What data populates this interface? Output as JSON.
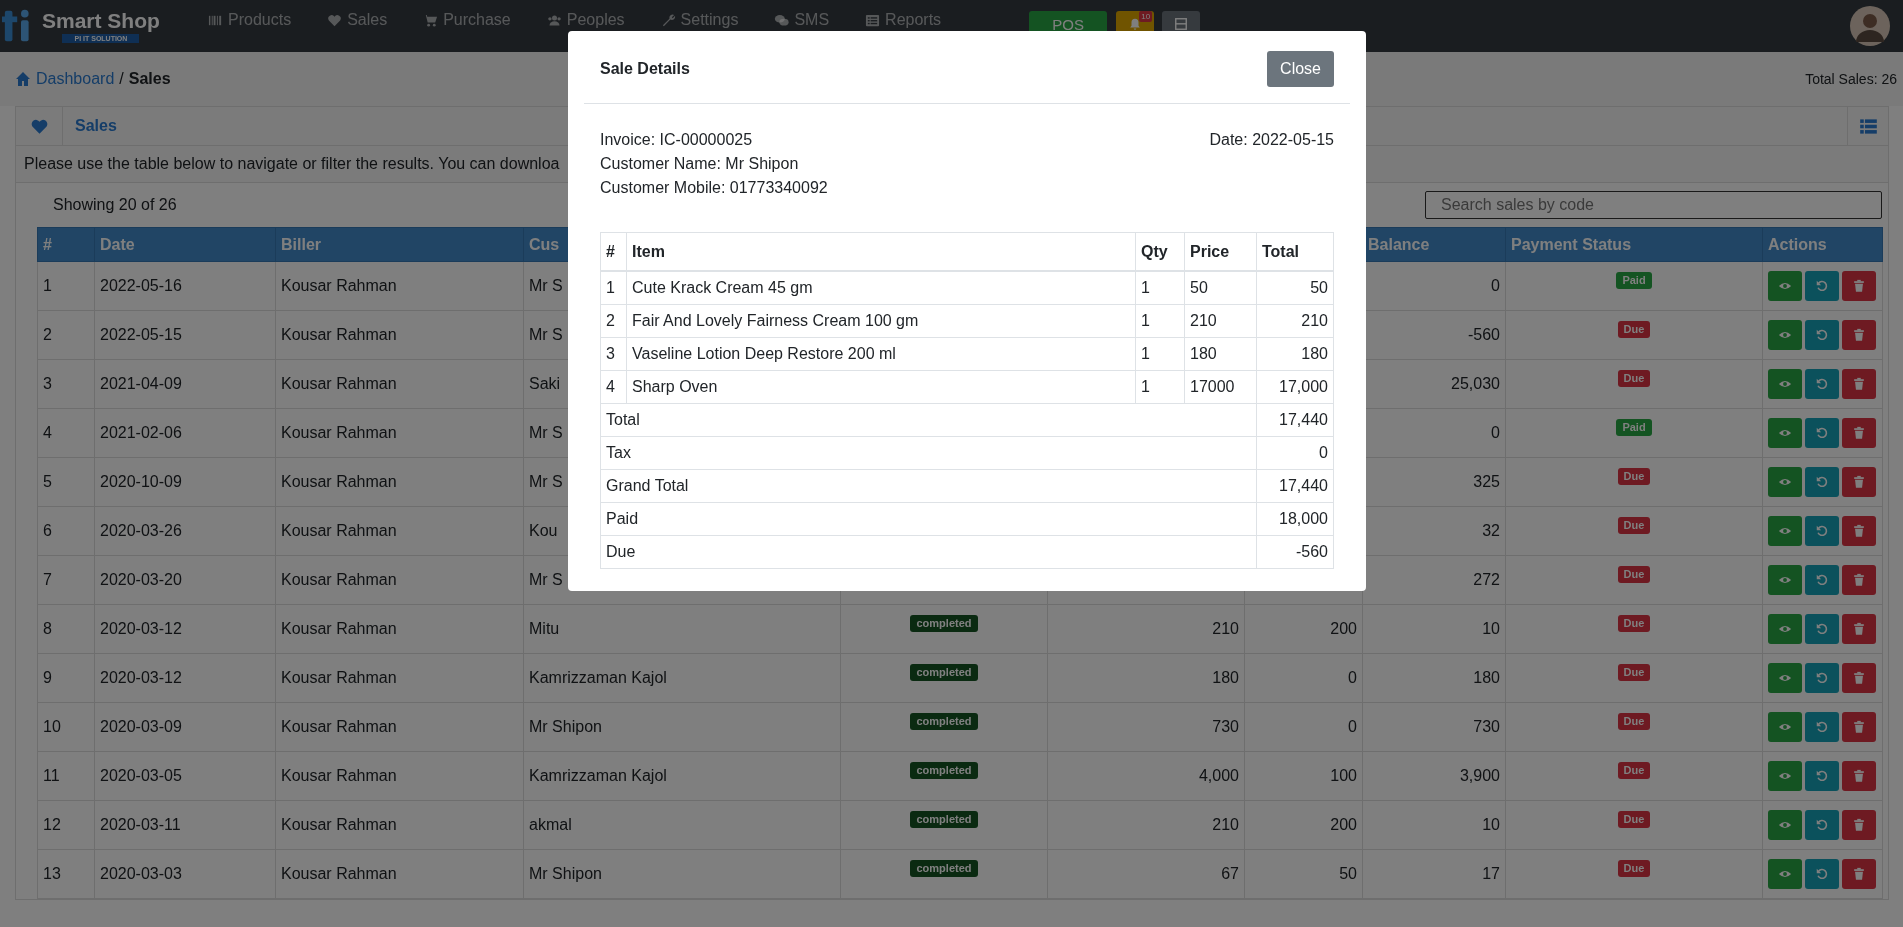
{
  "nav": {
    "brand": "Smart Shop",
    "tagline": "PI IT SOLUTION",
    "items": [
      {
        "label": "Products"
      },
      {
        "label": "Sales"
      },
      {
        "label": "Purchase"
      },
      {
        "label": "Peoples"
      },
      {
        "label": "Settings"
      },
      {
        "label": "SMS"
      },
      {
        "label": "Reports"
      }
    ],
    "pos_label": "POS",
    "notification_count": "10"
  },
  "breadcrumb": {
    "home": "Dashboard",
    "separator": "/",
    "current": "Sales",
    "total": "Total Sales: 26"
  },
  "card": {
    "title": "Sales",
    "description": "Please use the table below to navigate or filter the results. You can downloa",
    "showing": "Showing 20 of 26",
    "search": {
      "placeholder": "Search sales by code"
    }
  },
  "table": {
    "columns": {
      "number": "#",
      "date": "Date",
      "biller": "Biller",
      "customer": "Cus",
      "balance": "Balance",
      "payment_status": "Payment Status",
      "actions": "Actions"
    },
    "rows": [
      {
        "number": "1",
        "date": "2022-05-16",
        "biller": "Kousar Rahman",
        "customer": "Mr S",
        "balance": "0",
        "payment_status": "Paid",
        "color": "#145422"
      },
      {
        "number": "2",
        "date": "2022-05-15",
        "biller": "Kousar Rahman",
        "customer": "Mr S",
        "balance": "-560",
        "payment_status": "Due",
        "color": "#6e1a22"
      },
      {
        "number": "3",
        "date": "2021-04-09",
        "biller": "Kousar Rahman",
        "customer": "Saki",
        "balance": "25,030",
        "payment_status": "Due",
        "color": "#6e1a22"
      },
      {
        "number": "4",
        "date": "2021-02-06",
        "biller": "Kousar Rahman",
        "customer": "Mr S",
        "balance": "0",
        "payment_status": "Paid",
        "color": "#145422"
      },
      {
        "number": "5",
        "date": "2020-10-09",
        "biller": "Kousar Rahman",
        "customer": "Mr S",
        "balance": "325",
        "payment_status": "Due",
        "color": "#6e1a22"
      },
      {
        "number": "6",
        "date": "2020-03-26",
        "biller": "Kousar Rahman",
        "customer": "Kou",
        "balance": "32",
        "payment_status": "Due",
        "color": "#6e1a22"
      },
      {
        "number": "7",
        "date": "2020-03-20",
        "biller": "Kousar Rahman",
        "customer": "Mr S",
        "balance": "272",
        "payment_status": "Due",
        "color": "#6e1a22"
      },
      {
        "number": "8",
        "date": "2020-03-12",
        "biller": "Kousar Rahman",
        "customer": "Mitu",
        "sale_status": "completed",
        "grand_total": "210",
        "paid": "200",
        "balance": "10",
        "payment_status": "Due",
        "color": "#6e1a22"
      },
      {
        "number": "9",
        "date": "2020-03-12",
        "biller": "Kousar Rahman",
        "customer": "Kamrizzaman Kajol",
        "sale_status": "completed",
        "grand_total": "180",
        "paid": "0",
        "balance": "180",
        "payment_status": "Due",
        "color": "#6e1a22"
      },
      {
        "number": "10",
        "date": "2020-03-09",
        "biller": "Kousar Rahman",
        "customer": "Mr Shipon",
        "sale_status": "completed",
        "grand_total": "730",
        "paid": "0",
        "balance": "730",
        "payment_status": "Due",
        "color": "#6e1a22"
      },
      {
        "number": "11",
        "date": "2020-03-05",
        "biller": "Kousar Rahman",
        "customer": "Kamrizzaman Kajol",
        "sale_status": "completed",
        "grand_total": "4,000",
        "paid": "100",
        "balance": "3,900",
        "payment_status": "Due",
        "color": "#6e1a22"
      },
      {
        "number": "12",
        "date": "2020-03-11",
        "biller": "Kousar Rahman",
        "customer": "akmal",
        "sale_status": "completed",
        "grand_total": "210",
        "paid": "200",
        "balance": "10",
        "payment_status": "Due",
        "color": "#6e1a22"
      },
      {
        "number": "13",
        "date": "2020-03-03",
        "biller": "Kousar Rahman",
        "customer": "Mr Shipon",
        "sale_status": "completed",
        "grand_total": "67",
        "paid": "50",
        "balance": "17",
        "payment_status": "Due",
        "color": "#6e1a22"
      }
    ]
  },
  "modal": {
    "title": "Sale Details",
    "close": "Close",
    "invoice": "Invoice: IC-00000025",
    "customer_name": "Customer Name: Mr Shipon",
    "customer_mobile": "Customer Mobile: 01773340092",
    "date": "Date: 2022-05-15",
    "columns": [
      "#",
      "Item",
      "Qty",
      "Price",
      "Total"
    ],
    "items": [
      {
        "number": "1",
        "item": "Cute Krack Cream 45 gm",
        "qty": "1",
        "price": "50",
        "total": "50"
      },
      {
        "number": "2",
        "item": "Fair And Lovely Fairness Cream 100 gm",
        "qty": "1",
        "price": "210",
        "total": "210"
      },
      {
        "number": "3",
        "item": "Vaseline Lotion Deep Restore 200 ml",
        "qty": "1",
        "price": "180",
        "total": "180"
      },
      {
        "number": "4",
        "item": "Sharp Oven",
        "qty": "1",
        "price": "17000",
        "total": "17,000"
      }
    ],
    "summary": [
      {
        "label": "Total",
        "value": "17,440"
      },
      {
        "label": "Tax",
        "value": "0"
      },
      {
        "label": "Grand Total",
        "value": "17,440"
      },
      {
        "label": "Paid",
        "value": "18,000"
      },
      {
        "label": "Due",
        "value": "-560"
      }
    ]
  }
}
